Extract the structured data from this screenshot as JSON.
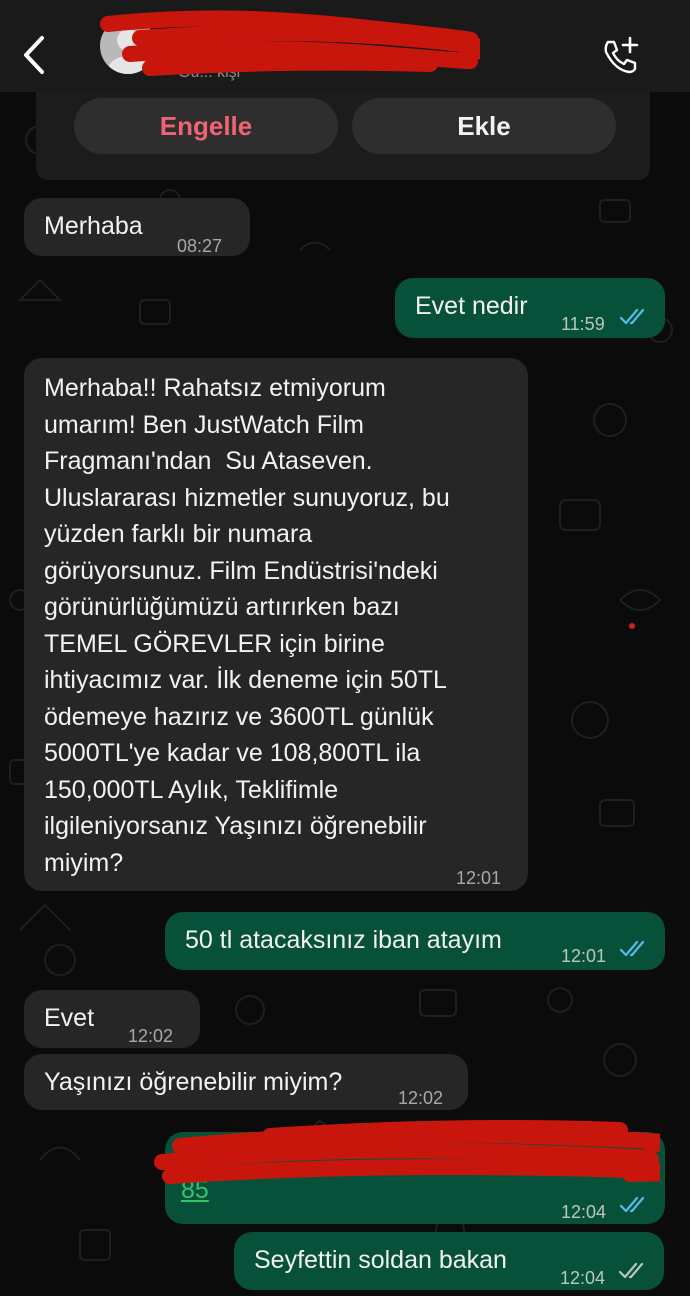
{
  "header": {
    "contact_subtitle": "Gu... kişi",
    "back_icon": "chevron-left-icon",
    "call_icon": "add-call-icon"
  },
  "unknown_contact": {
    "block_label": "Engelle",
    "add_label": "Ekle"
  },
  "messages": [
    {
      "dir": "in",
      "text": "Merhaba",
      "time": "08:27"
    },
    {
      "dir": "out",
      "text": "Evet nedir",
      "time": "11:59",
      "status": "read"
    },
    {
      "dir": "in",
      "lines": [
        "Merhaba!! Rahatsız etmiyorum",
        "umarım! Ben JustWatch Film",
        "Fragmanı'ndan  Su Ataseven.",
        "Uluslararası hizmetler sunuyoruz, bu",
        "yüzden farklı bir numara",
        "görüyorsunuz. Film Endüstrisi'ndeki",
        "görünürlüğümüzü artırırken bazı",
        "TEMEL GÖREVLER için birine",
        "ihtiyacımız var. İlk deneme için 50TL",
        "ödemeye hazırız ve 3600TL günlük",
        "5000TL'ye kadar ve 108,800TL ila",
        "150,000TL Aylık, Teklifimle",
        "ilgileniyorsanız Yaşınızı öğrenebilir",
        "miyim?"
      ],
      "time": "12:01"
    },
    {
      "dir": "out",
      "text": "50 tl atacaksınız iban atayım",
      "time": "12:01",
      "status": "read"
    },
    {
      "dir": "in",
      "text": "Evet",
      "time": "12:02"
    },
    {
      "dir": "in",
      "text": "Yaşınızı öğrenebilir miyim?",
      "time": "12:02"
    },
    {
      "dir": "out",
      "text": "85",
      "time": "12:04",
      "status": "read"
    },
    {
      "dir": "out",
      "text": "Seyfettin soldan bakan",
      "time": "12:04",
      "status": "delivered"
    }
  ],
  "colors": {
    "incoming_bubble": "#262626",
    "outgoing_bubble": "#07513a",
    "read_tick": "#53bdeb",
    "block_text": "#f06374",
    "link": "#35c46b"
  }
}
